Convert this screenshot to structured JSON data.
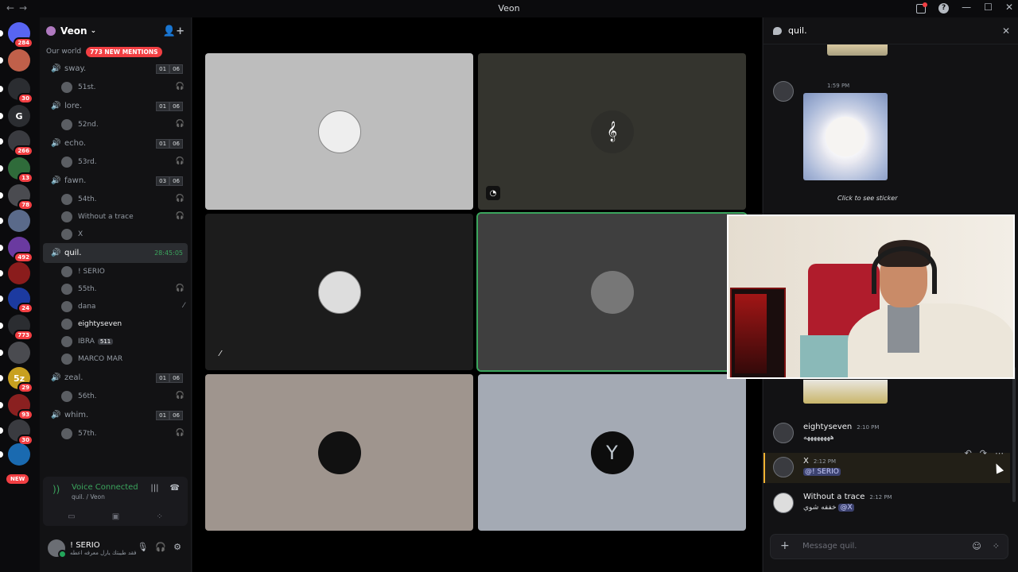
{
  "window": {
    "title": "Veon"
  },
  "rail": {
    "servers": [
      {
        "badge": "284",
        "color": "#5865f2",
        "label": ""
      },
      {
        "badge": "",
        "color": "#c0604a",
        "label": ""
      },
      {
        "badge": "30",
        "color": "#2b2d31",
        "label": ""
      },
      {
        "badge": "",
        "color": "#2b2d31",
        "label": "G"
      },
      {
        "badge": "266",
        "color": "#3a3b40",
        "label": ""
      },
      {
        "badge": "13",
        "color": "#2f6b3a",
        "label": ""
      },
      {
        "badge": "78",
        "color": "#4a4b50",
        "label": ""
      },
      {
        "badge": "",
        "color": "#5a6a8a",
        "label": ""
      },
      {
        "badge": "492",
        "color": "#6a3aa0",
        "label": ""
      },
      {
        "badge": "",
        "color": "#8a1c1c",
        "label": ""
      },
      {
        "badge": "24",
        "color": "#1c3aa0",
        "label": ""
      },
      {
        "badge": "773",
        "color": "#2b2d31",
        "label": ""
      },
      {
        "badge": "",
        "color": "#4a4b50",
        "label": ""
      },
      {
        "badge": "29",
        "color": "#c8a020",
        "label": "5z"
      },
      {
        "badge": "93",
        "color": "#8a2020",
        "label": ""
      },
      {
        "badge": "30",
        "color": "#3a3b40",
        "label": ""
      },
      {
        "badge": "",
        "color": "#1a6ab0",
        "label": ""
      }
    ],
    "new_label": "NEW"
  },
  "server": {
    "name": "Veon",
    "category": "Our world",
    "mentions": "773 NEW MENTIONS"
  },
  "channels": [
    {
      "name": "sway.",
      "c1": "01",
      "c2": "06",
      "users": [
        {
          "name": "51st.",
          "deaf": true
        }
      ]
    },
    {
      "name": "lore.",
      "c1": "01",
      "c2": "06",
      "users": [
        {
          "name": "52nd.",
          "deaf": true
        }
      ]
    },
    {
      "name": "echo.",
      "c1": "01",
      "c2": "06",
      "users": [
        {
          "name": "53rd.",
          "deaf": true
        }
      ]
    },
    {
      "name": "fawn.",
      "c1": "03",
      "c2": "06",
      "users": [
        {
          "name": "54th.",
          "deaf": true
        },
        {
          "name": "Without a trace",
          "deaf": true
        },
        {
          "name": "X",
          "deaf": false
        }
      ]
    }
  ],
  "active_channel": {
    "name": "quil.",
    "timer": "28:45:05",
    "users": [
      {
        "name": "! SERIO",
        "deaf": false,
        "muted": false
      },
      {
        "name": "55th.",
        "deaf": true,
        "muted": false
      },
      {
        "name": "dana",
        "deaf": false,
        "muted": true
      },
      {
        "name": "eightyseven",
        "deaf": false,
        "muted": false
      },
      {
        "name": "IBRA",
        "boost": "511",
        "deaf": false,
        "muted": false
      },
      {
        "name": "MARCO MAR",
        "deaf": false,
        "muted": false
      }
    ]
  },
  "channels_after": [
    {
      "name": "zeal.",
      "c1": "01",
      "c2": "06",
      "users": [
        {
          "name": "56th.",
          "deaf": true
        }
      ]
    },
    {
      "name": "whim.",
      "c1": "01",
      "c2": "06",
      "users": [
        {
          "name": "57th.",
          "deaf": true
        }
      ]
    }
  ],
  "voice": {
    "status": "Voice Connected",
    "location": "quil. / Veon"
  },
  "user": {
    "name": "! SERIO",
    "status": "فقد طيبتك يارل معرفه اعطه"
  },
  "chat": {
    "title": "quil.",
    "time1": "1:59 PM",
    "click_sticker": "Click to see sticker",
    "messages": [
      {
        "author": "eightyseven",
        "time": "2:10 PM",
        "text": "ههههههههه"
      },
      {
        "author": "X",
        "time": "2:12 PM",
        "text": "@! SERIO"
      },
      {
        "author": "Without a trace",
        "time": "2:12 PM",
        "text": "خففه شوي",
        "mention": "@X"
      }
    ],
    "placeholder": "Message quil."
  }
}
